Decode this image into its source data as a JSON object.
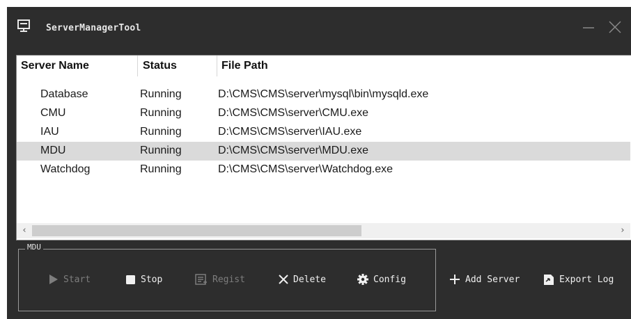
{
  "window": {
    "title": "ServerManagerTool"
  },
  "table": {
    "headers": [
      "Server Name",
      "Status",
      "File Path"
    ],
    "rows": [
      {
        "name": "Database",
        "status": "Running",
        "path": "D:\\CMS\\CMS\\server\\mysql\\bin\\mysqld.exe",
        "selected": false
      },
      {
        "name": "CMU",
        "status": "Running",
        "path": "D:\\CMS\\CMS\\server\\CMU.exe",
        "selected": false
      },
      {
        "name": "IAU",
        "status": "Running",
        "path": "D:\\CMS\\CMS\\server\\IAU.exe",
        "selected": false
      },
      {
        "name": "MDU",
        "status": "Running",
        "path": "D:\\CMS\\CMS\\server\\MDU.exe",
        "selected": true
      },
      {
        "name": "Watchdog",
        "status": "Running",
        "path": "D:\\CMS\\CMS\\server\\Watchdog.exe",
        "selected": false
      }
    ]
  },
  "group": {
    "label": "MDU",
    "buttons": {
      "start": {
        "label": "Start",
        "icon": "play-icon",
        "enabled": false
      },
      "stop": {
        "label": "Stop",
        "icon": "stop-icon",
        "enabled": true
      },
      "regist": {
        "label": "Regist",
        "icon": "regist-icon",
        "enabled": false
      },
      "delete": {
        "label": "Delete",
        "icon": "x-icon",
        "enabled": true
      },
      "config": {
        "label": "Config",
        "icon": "gear-icon",
        "enabled": true
      }
    }
  },
  "actions": {
    "add_server": {
      "label": "Add Server",
      "icon": "plus-icon"
    },
    "export_log": {
      "label": "Export Log",
      "icon": "export-icon"
    }
  },
  "colors": {
    "titlebar_bg": "#2d2d2d",
    "selected_row": "#dadada",
    "button_text": "#f0f0f0",
    "disabled_text": "#7d7d7d"
  }
}
